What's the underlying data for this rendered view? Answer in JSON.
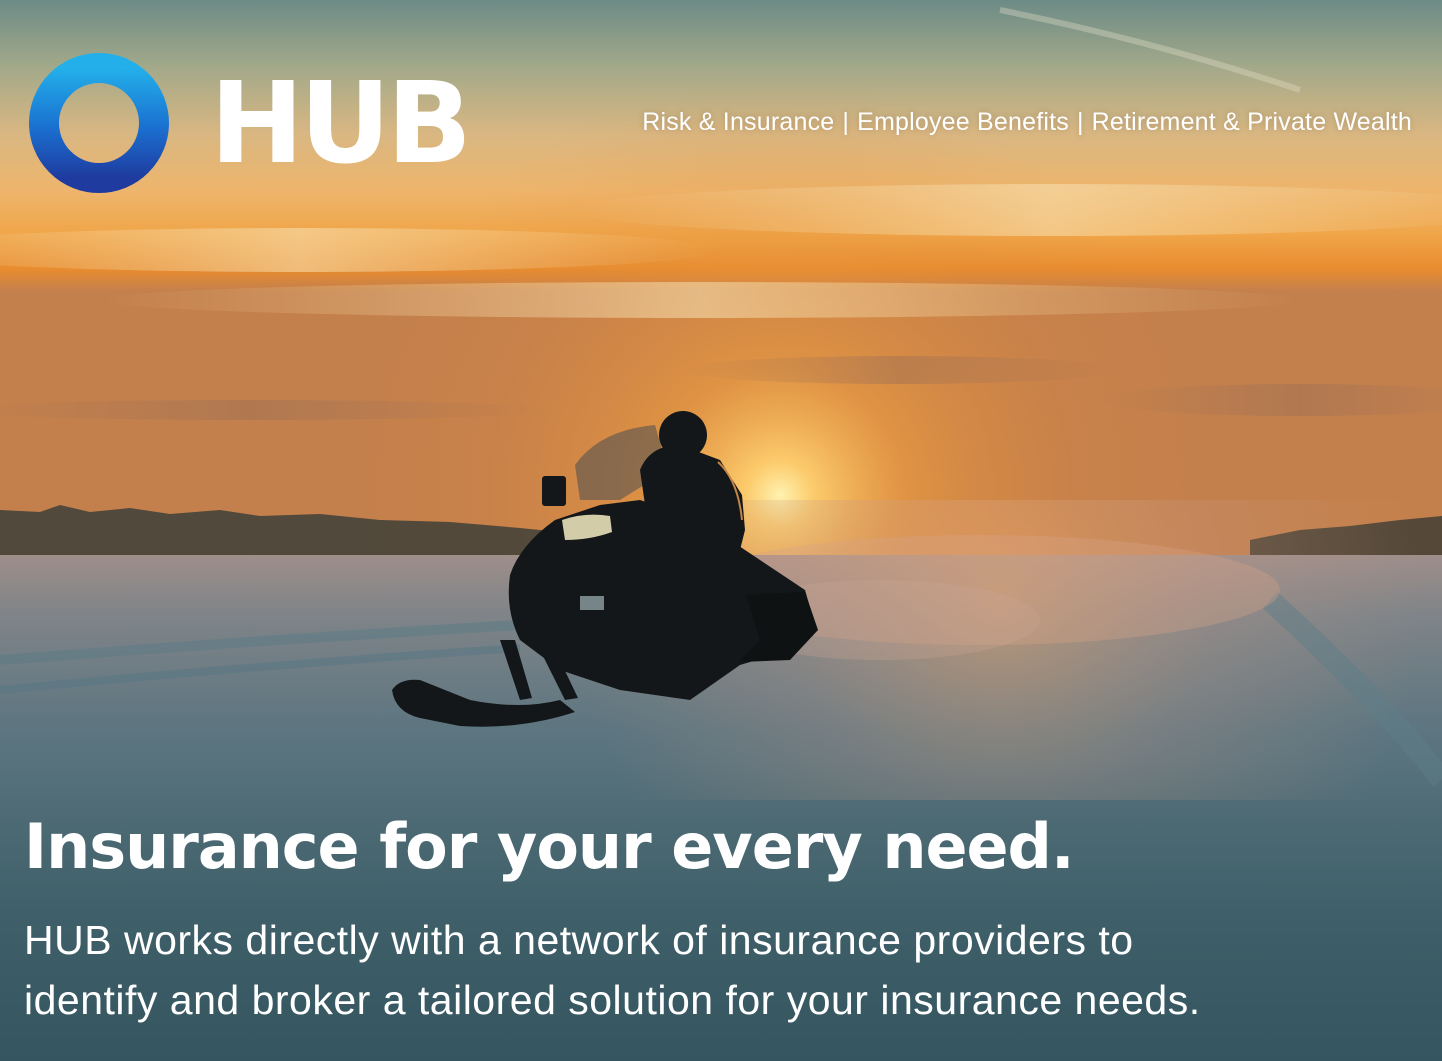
{
  "brand": {
    "name": "HUB",
    "ring_gradient": [
      "#1fa9e6",
      "#1b5fc4",
      "#1e3a9e"
    ],
    "text_color": "#ffffff"
  },
  "tagline": {
    "items": [
      "Risk & Insurance",
      "Employee Benefits",
      "Retirement & Private Wealth"
    ],
    "separator": "|"
  },
  "headline": "Insurance for your every need.",
  "body": {
    "line1": "HUB works directly with a network of insurance providers to",
    "line2": "identify and broker a tailored solution for your insurance needs."
  },
  "colors": {
    "sky_top": "#6f8f8c",
    "sky_glow": "#f3a94a",
    "sun": "#ffd27a",
    "snow": "#3f6672"
  }
}
